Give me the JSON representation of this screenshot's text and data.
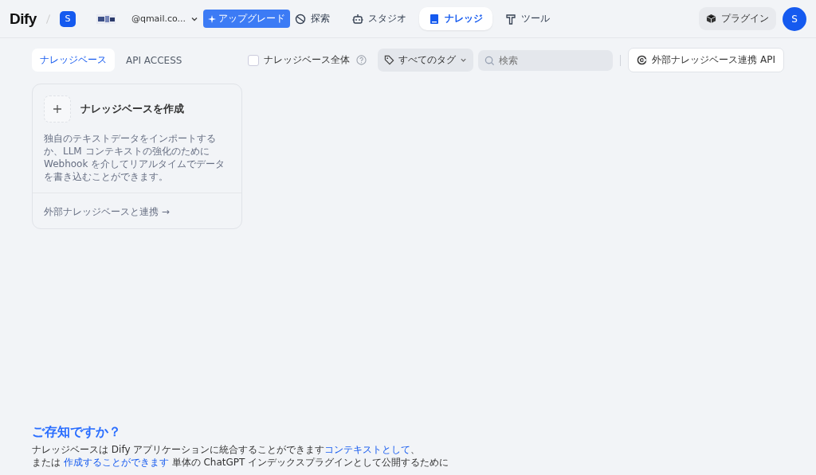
{
  "header": {
    "logo": "Dify",
    "workspace_initial": "S",
    "account": "@qmail.co...",
    "upgrade": "アップグレード",
    "nav": [
      {
        "label": "探索",
        "kind": "explore",
        "selected": false
      },
      {
        "label": "スタジオ",
        "kind": "studio",
        "selected": false
      },
      {
        "label": "ナレッジ",
        "kind": "book",
        "selected": true
      },
      {
        "label": "ツール",
        "kind": "tool",
        "selected": false
      }
    ],
    "plugin": "プラグイン",
    "avatar": "S"
  },
  "tabs": [
    {
      "label": "ナレッジベース",
      "selected": true
    },
    {
      "label": "API ACCESS",
      "selected": false
    }
  ],
  "filters": {
    "all_knowledge": {
      "label": "ナレッジベース全体",
      "checked": false
    },
    "tags": "すべてのタグ",
    "search": {
      "placeholder": "検索"
    },
    "external_api": "外部ナレッジベース連携 API"
  },
  "create_card": {
    "title": "ナレッジベースを作成",
    "description": "独自のテキストデータをインポートするか、LLM コンテキストの強化のために Webhook を介してリアルタイムでデータを書き込むことができます。",
    "link": "外部ナレッジベースと連携 →"
  },
  "tip": {
    "title": "ご存知ですか？",
    "lines": [
      [
        {
          "text": "ナレッジベースは Dify アプリケーションに統合することができます",
          "link": false
        },
        {
          "text": "コンテキストとして",
          "link": true
        },
        {
          "text": "、",
          "link": false
        }
      ],
      [
        {
          "text": "または ",
          "link": false
        },
        {
          "text": "作成することができます",
          "link": true
        },
        {
          "text": " 単体の ChatGPT インデックスプラグインとして公開するために",
          "link": false
        }
      ]
    ]
  }
}
